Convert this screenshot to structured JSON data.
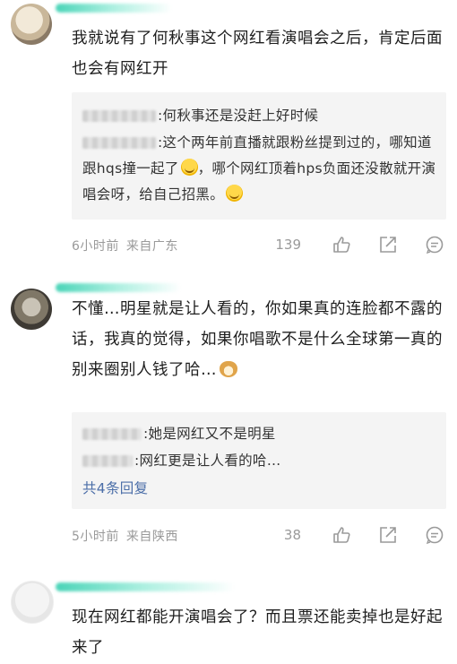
{
  "comments": [
    {
      "text": "我就说有了何秋事这个网红看演唱会之后，肯定后面也会有网红开",
      "replies": [
        {
          "text": ":何秋事还是没赶上好时候"
        },
        {
          "text_a": ":这个两年前直播就跟粉丝提到过的，哪知道跟hqs撞一起了",
          "text_b": "，哪个网红顶着hps负面还没散就开演唱会呀，给自己招黑。"
        }
      ],
      "time": "6小时前",
      "location": "来自广东",
      "likes": "139"
    },
    {
      "text": "不懂…明星就是让人看的，你如果真的连脸都不露的话，我真的觉得，如果你唱歌不是什么全球第一真的别来圈别人钱了哈…",
      "replies": [
        {
          "text": ":她是网红又不是明星"
        },
        {
          "text": ":网红更是让人看的哈…"
        }
      ],
      "more_replies": "共4条回复",
      "time": "5小时前",
      "location": "来自陕西",
      "likes": "38"
    },
    {
      "text": "现在网红都能开演唱会了？而且票还能卖掉也是好起来了"
    }
  ],
  "icons": [
    "like-icon",
    "share-icon",
    "reply-icon",
    "laugh-cry-emoji",
    "doge-emoji"
  ],
  "colors": {
    "meta": "#9a9a9a",
    "reply_bg": "#f4f4f4",
    "link": "#4b6ea8",
    "name_mask": "#40d2b4"
  }
}
